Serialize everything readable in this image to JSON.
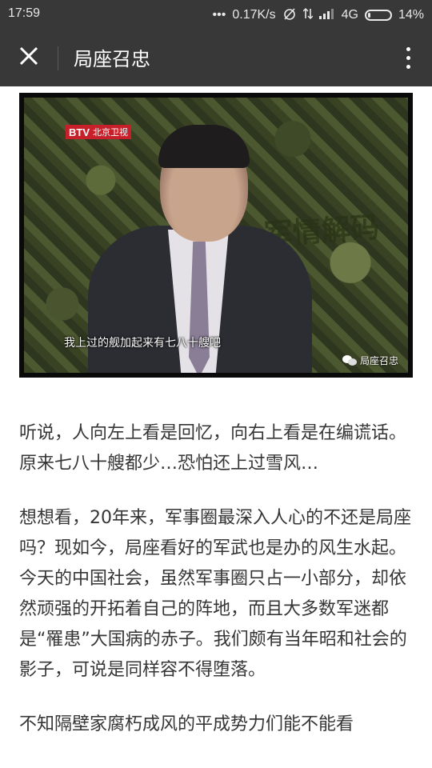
{
  "status_bar": {
    "time": "17:59",
    "dots": "•••",
    "net_speed": "0.17K/s",
    "network_type": "4G",
    "battery_percent": "14%",
    "icons": [
      "alarm-off-icon",
      "data-transfer-icon",
      "signal-icon",
      "battery-icon"
    ]
  },
  "header": {
    "title": "局座召忠",
    "close_icon": "close-icon",
    "more_icon": "more-vertical-icon"
  },
  "media": {
    "tv_logo": "BTV",
    "tv_channel": "北京卫视",
    "show_logo": "军情解码",
    "subtitle": "我上过的舰加起来有七八十艘吧",
    "watermark": "局座召忠"
  },
  "article": {
    "paragraphs": [
      "听说，人向左上看是回忆，向右上看是在编谎话。原来七八十艘都少…恐怕还上过雪风…",
      "想想看，20年来，军事圈最深入人心的不还是局座吗？现如今，局座看好的军武也是办的风生水起。今天的中国社会，虽然军事圈只占一小部分，却依然顽强的开拓着自己的阵地，而且大多数军迷都是“罹患”大国病的赤子。我们颇有当年昭和社会的影子，可说是同样容不得堕落。",
      "不知隔壁家腐朽成风的平成势力们能不能看"
    ]
  }
}
